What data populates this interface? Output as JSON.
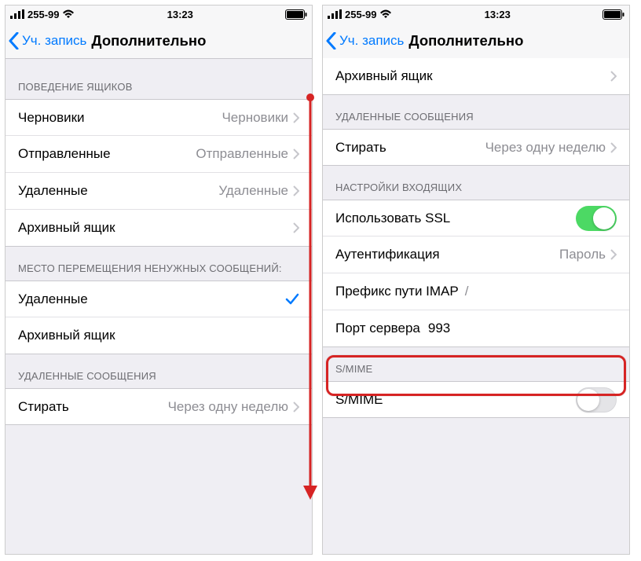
{
  "status": {
    "carrier": "255-99",
    "time": "13:23"
  },
  "nav": {
    "back": "Уч. запись",
    "title": "Дополнительно"
  },
  "left": {
    "sec1_header": "ПОВЕДЕНИЕ ЯЩИКОВ",
    "drafts_label": "Черновики",
    "drafts_value": "Черновики",
    "sent_label": "Отправленные",
    "sent_value": "Отправленные",
    "deleted_label": "Удаленные",
    "deleted_value": "Удаленные",
    "archive_label": "Архивный ящик",
    "sec2_header": "МЕСТО ПЕРЕМЕЩЕНИЯ НЕНУЖНЫХ СООБЩЕНИЙ:",
    "opt_deleted": "Удаленные",
    "opt_archive": "Архивный ящик",
    "sec3_header": "УДАЛЕННЫЕ СООБЩЕНИЯ",
    "erase_label": "Стирать",
    "erase_value": "Через одну неделю"
  },
  "right": {
    "archive_label": "Архивный ящик",
    "sec_del_header": "УДАЛЕННЫЕ СООБЩЕНИЯ",
    "erase_label": "Стирать",
    "erase_value": "Через одну неделю",
    "sec_in_header": "НАСТРОЙКИ ВХОДЯЩИХ",
    "ssl_label": "Использовать SSL",
    "auth_label": "Аутентификация",
    "auth_value": "Пароль",
    "imap_label": "Префикс пути IMAP",
    "imap_value": "/",
    "port_label": "Порт сервера",
    "port_value": "993",
    "sec_smime_header": "S/MIME",
    "smime_label": "S/MIME"
  }
}
